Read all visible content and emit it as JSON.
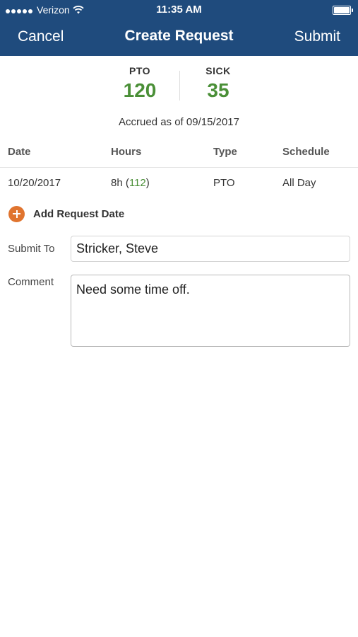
{
  "status_bar": {
    "carrier": "Verizon",
    "time": "11:35 AM"
  },
  "nav": {
    "cancel_label": "Cancel",
    "title": "Create Request",
    "submit_label": "Submit"
  },
  "balances": {
    "pto": {
      "label": "PTO",
      "value": "120"
    },
    "sick": {
      "label": "SICK",
      "value": "35"
    },
    "accrued_text": "Accrued as of 09/15/2017"
  },
  "table": {
    "headers": [
      "Date",
      "Hours",
      "Type",
      "Schedule"
    ],
    "rows": [
      {
        "date": "10/20/2017",
        "hours": "8h",
        "hours_remaining": "112",
        "type": "PTO",
        "schedule": "All Day"
      }
    ]
  },
  "add_request_label": "Add Request Date",
  "form": {
    "submit_to_label": "Submit To",
    "submit_to_value": "Stricker, Steve",
    "comment_label": "Comment",
    "comment_value": "Need some time off."
  },
  "colors": {
    "nav_background": "#1f4b7d",
    "balance_green": "#4a8f37",
    "add_button_orange": "#e0742f"
  }
}
